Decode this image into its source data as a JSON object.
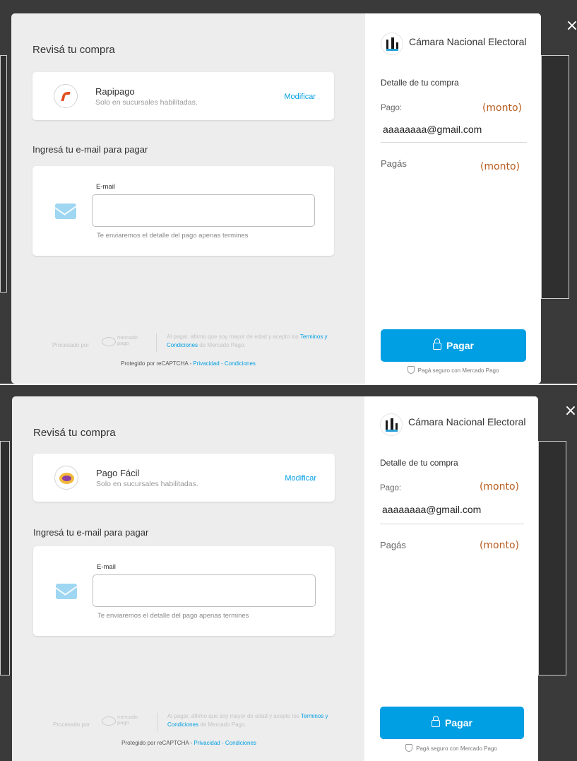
{
  "views": [
    {
      "close_icon": "×",
      "review_title": "Revisá tu compra",
      "payment_method": {
        "logo_icon": "rapipago-logo-icon",
        "name": "Rapipago",
        "subtitle": "Solo en sucursales habilitadas.",
        "modify_label": "Modificar"
      },
      "email_section": {
        "title": "Ingresá tu e-mail para pagar",
        "field_label": "E-mail",
        "input_value": "",
        "hint": "Te enviaremos el detalle del pago apenas termines"
      },
      "footer": {
        "processed_by": "Procesado por",
        "mp_logo_text": "mercado pago",
        "legal_prefix": "Al pagar, afirmo que soy mayor de edad y acepto los",
        "legal_link": "Terminos y Condiciones",
        "legal_suffix": "de Mercado Pago.",
        "captcha_prefix": "Protegido por reCAPTCHA -",
        "privacy_link": "Privacidad",
        "captcha_sep": "-",
        "conditions_link": "Condiciones"
      },
      "summary": {
        "merchant_name": "Cámara Nacional Electoral",
        "detail_title": "Detalle de tu compra",
        "pago_label": "Pago:",
        "pago_amount": "(monto)",
        "email": "aaaaaaaa@gmail.com",
        "pagas_label": "Pagás",
        "pagas_amount": "(monto)",
        "pay_button": "Pagar",
        "secure_text": "Pagá seguro con Mercado Pago"
      }
    },
    {
      "close_icon": "×",
      "review_title": "Revisá tu compra",
      "payment_method": {
        "logo_icon": "pago-facil-logo-icon",
        "name": "Pago Fácil",
        "subtitle": "Solo en sucursales habilitadas.",
        "modify_label": "Modificar"
      },
      "email_section": {
        "title": "Ingresá tu e-mail para pagar",
        "field_label": "E-mail",
        "input_value": "",
        "hint": "Te enviaremos el detalle del pago apenas termines"
      },
      "footer": {
        "processed_by": "Procesado por",
        "mp_logo_text": "mercado pago",
        "legal_prefix": "Al pagar, afirmo que soy mayor de edad y acepto los",
        "legal_link": "Terminos y Condiciones",
        "legal_suffix": "de Mercado Pago.",
        "captcha_prefix": "Protegido por reCAPTCHA -",
        "privacy_link": "Privacidad",
        "captcha_sep": "-",
        "conditions_link": "Condiciones"
      },
      "summary": {
        "merchant_name": "Cámara Nacional Electoral",
        "detail_title": "Detalle de tu compra",
        "pago_label": "Pago:",
        "pago_amount": "(monto)",
        "email": "aaaaaaaa@gmail.com",
        "pagas_label": "Pagás",
        "pagas_amount": "(monto)",
        "pay_button": "Pagar",
        "secure_text": "Pagá seguro con Mercado Pago"
      }
    }
  ],
  "colors": {
    "accent": "#009ee3",
    "amount": "#b85c1e",
    "overlay": "#3a3a3a",
    "left_panel": "#ededed"
  }
}
